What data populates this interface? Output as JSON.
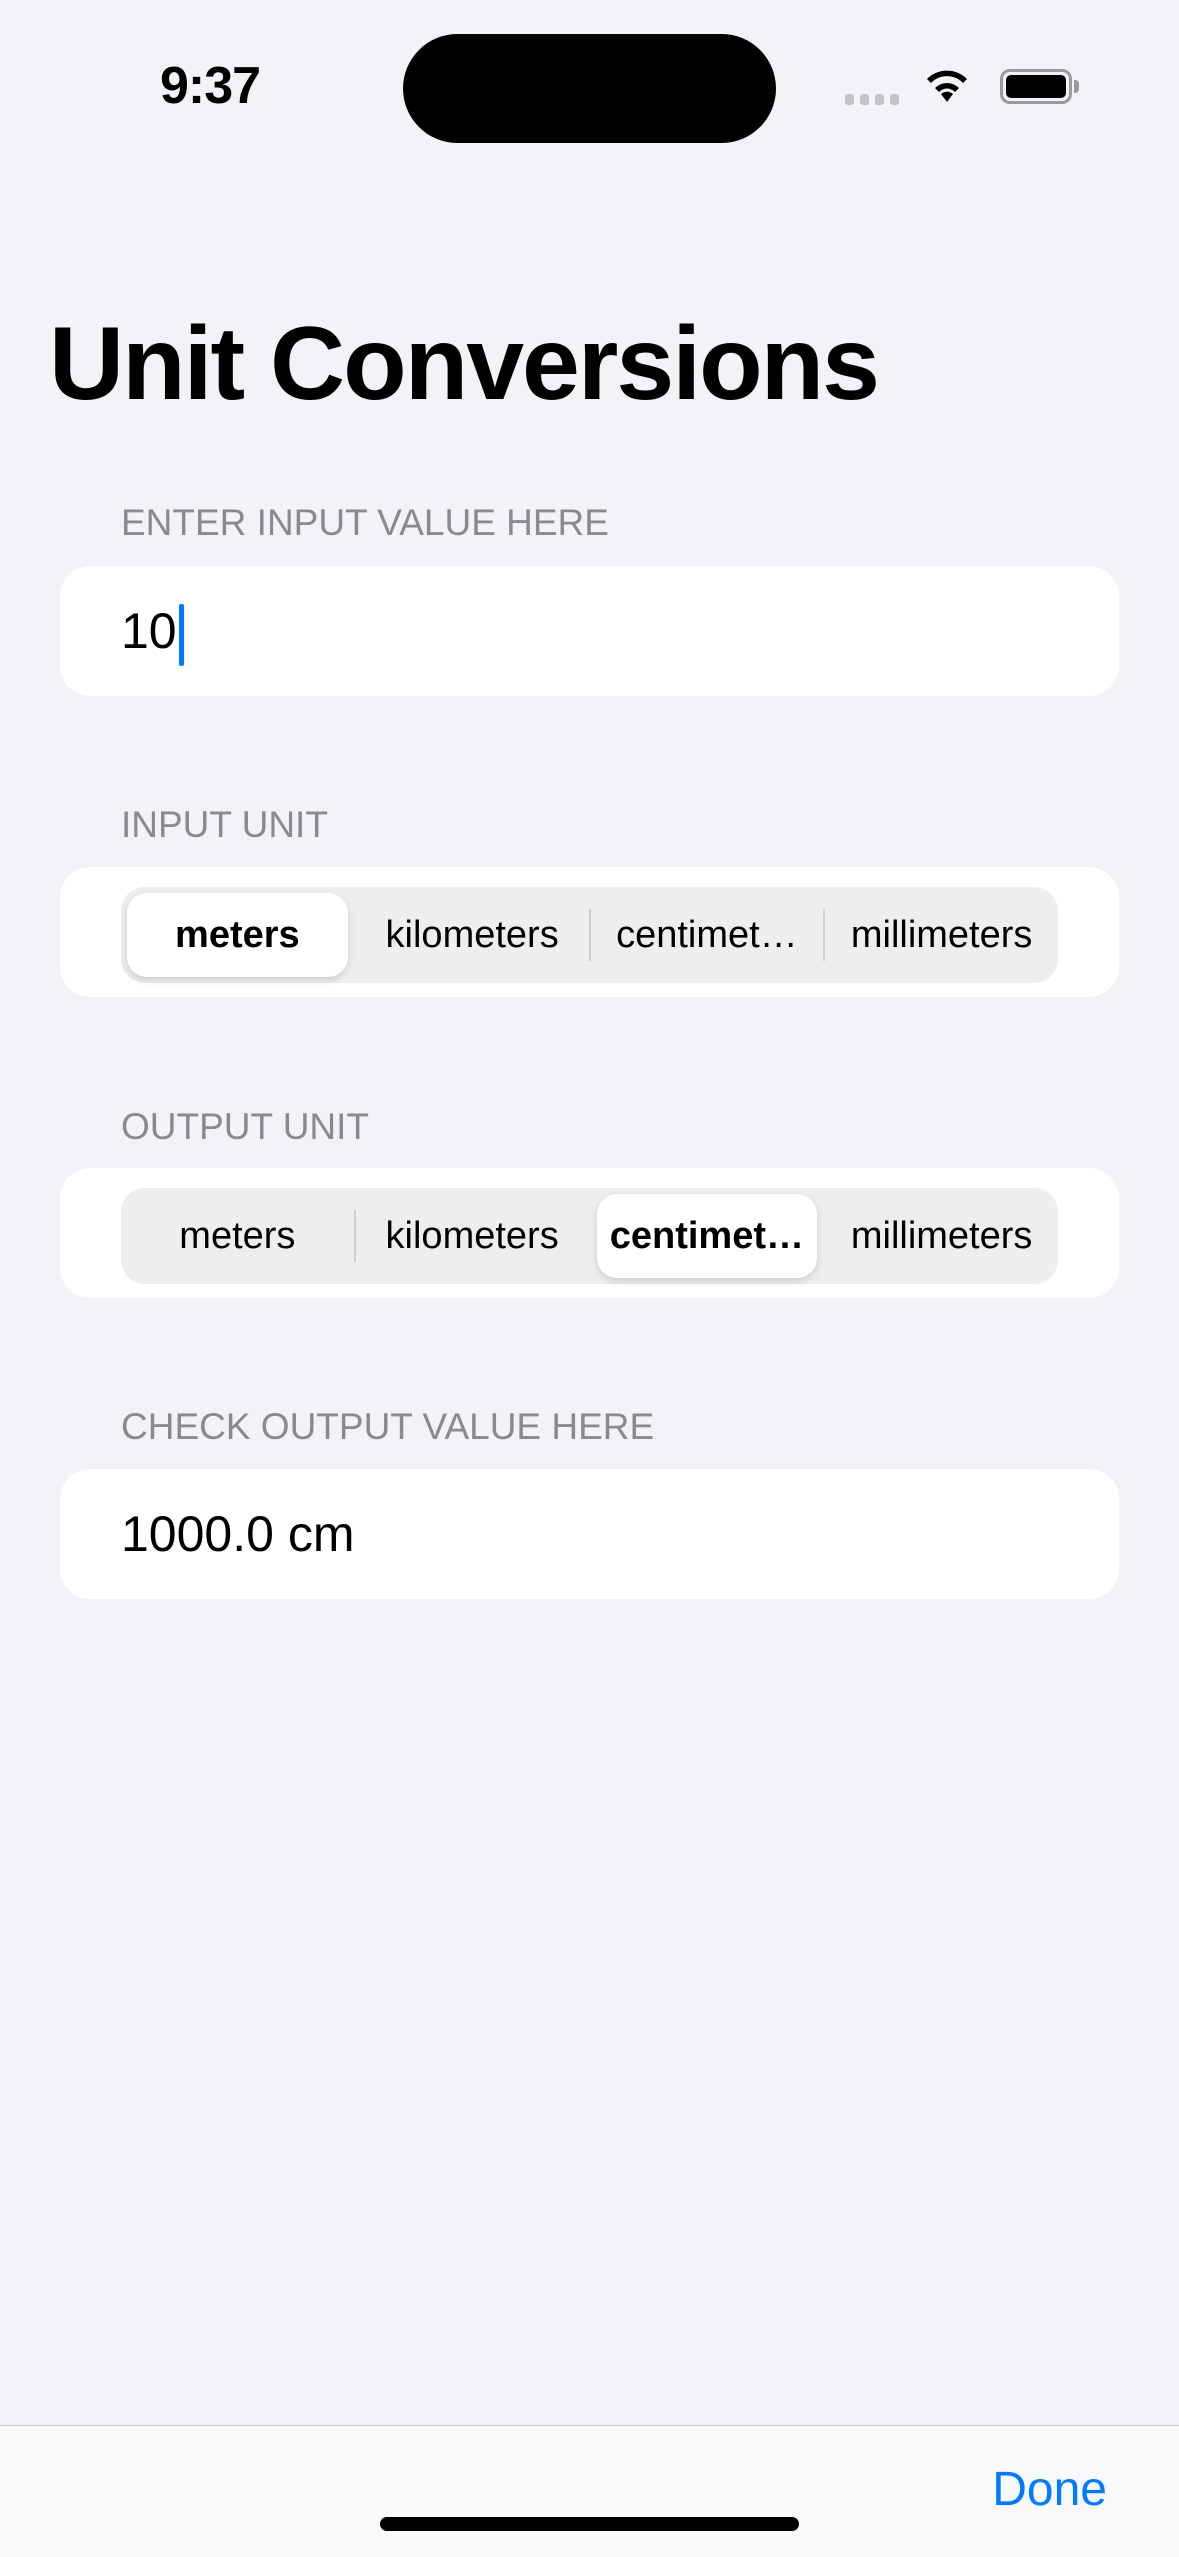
{
  "status_bar": {
    "time": "9:37"
  },
  "title": "Unit Conversions",
  "input_section": {
    "label": "ENTER INPUT VALUE HERE",
    "value": "10"
  },
  "input_unit": {
    "label": "INPUT UNIT",
    "options": [
      "meters",
      "kilometers",
      "centimet…",
      "millimeters"
    ],
    "selected": "meters"
  },
  "output_unit": {
    "label": "OUTPUT UNIT",
    "options": [
      "meters",
      "kilometers",
      "centimet…",
      "millimeters"
    ],
    "selected": "centimet…"
  },
  "output_section": {
    "label": "CHECK OUTPUT VALUE HERE",
    "value": "1000.0 cm"
  },
  "toolbar": {
    "done_label": "Done"
  },
  "colors": {
    "accent": "#007aff",
    "background": "#f2f2f7"
  }
}
